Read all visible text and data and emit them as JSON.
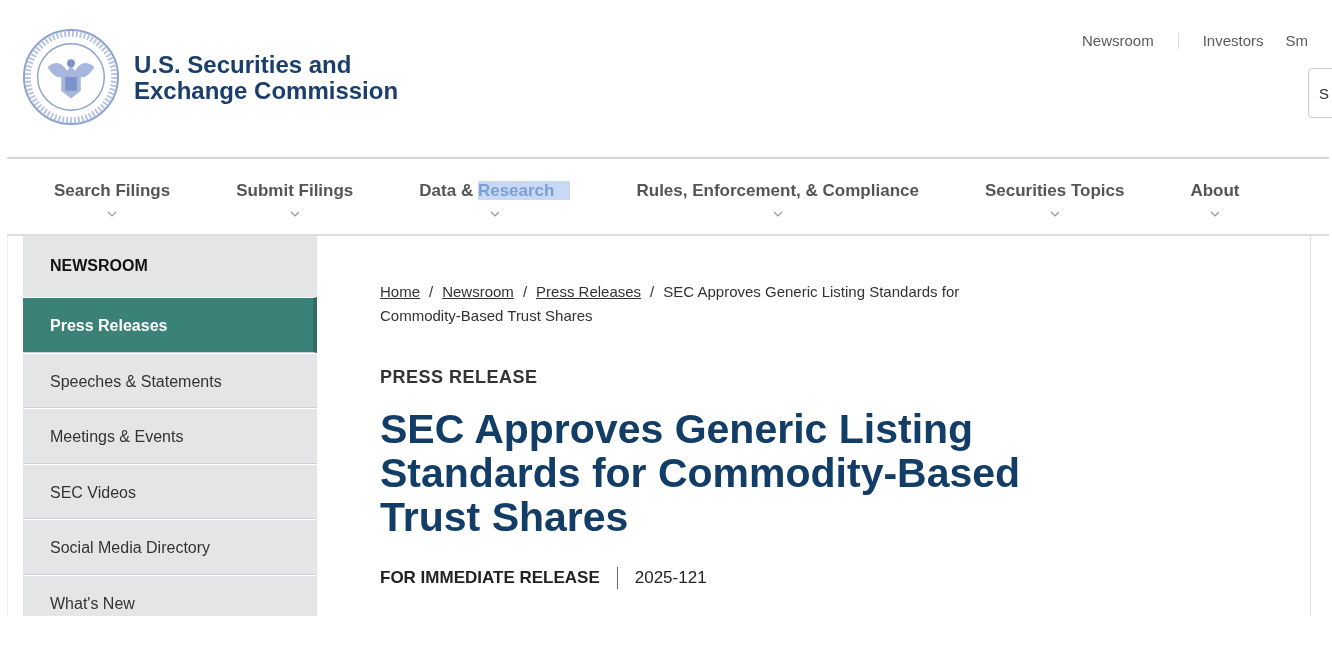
{
  "logo": {
    "title_lines": [
      "U.S. Securities and",
      "Exchange Commission"
    ]
  },
  "utility_links": [
    {
      "label": "Newsroom"
    },
    {
      "label": "Investors"
    },
    {
      "label": "Sm"
    }
  ],
  "search": {
    "placeholder": "S"
  },
  "main_nav": [
    {
      "label": "Search Filings"
    },
    {
      "label": "Submit Filings"
    },
    {
      "label": "Data &",
      "highlighted": "Research"
    },
    {
      "label": "Rules, Enforcement, & Compliance"
    },
    {
      "label": "Securities Topics"
    },
    {
      "label": "About"
    }
  ],
  "sidebar": {
    "heading": "NEWSROOM",
    "items": [
      {
        "label": "Press Releases",
        "selected": true
      },
      {
        "label": "Speeches & Statements",
        "selected": false
      },
      {
        "label": "Meetings & Events",
        "selected": false
      },
      {
        "label": "SEC Videos",
        "selected": false
      },
      {
        "label": "Social Media Directory",
        "selected": false
      },
      {
        "label": "What's New",
        "selected": false
      }
    ]
  },
  "breadcrumb": {
    "links": [
      "Home",
      "Newsroom",
      "Press Releases"
    ],
    "separators": [
      "/",
      "/",
      "/"
    ],
    "current_lines": [
      "SEC Approves Generic Listing Standards for",
      "Commodity-Based Trust Shares"
    ]
  },
  "article": {
    "eyebrow": "PRESS RELEASE",
    "title": "SEC Approves Generic Listing Standards for Commodity-Based Trust Shares",
    "release_label": "FOR IMMEDIATE RELEASE",
    "release_number": "2025-121"
  }
}
